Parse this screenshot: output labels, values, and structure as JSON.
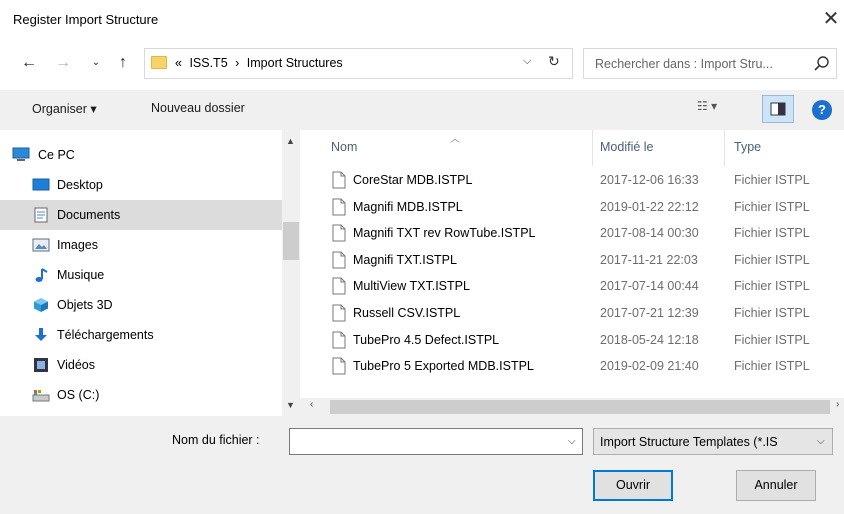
{
  "window": {
    "title": "Register Import Structure"
  },
  "address": {
    "overflow": "«",
    "crumbs": [
      "ISS.T5",
      "›",
      "Import Structures"
    ]
  },
  "search": {
    "placeholder": "Rechercher dans : Import Stru..."
  },
  "toolbar": {
    "organize": "Organiser ▾",
    "new_folder": "Nouveau dossier"
  },
  "nav": {
    "items": [
      {
        "label": "Ce PC",
        "icon": "computer-icon"
      },
      {
        "label": "Desktop",
        "icon": "desktop-icon"
      },
      {
        "label": "Documents",
        "icon": "documents-icon",
        "selected": true
      },
      {
        "label": "Images",
        "icon": "images-icon"
      },
      {
        "label": "Musique",
        "icon": "music-icon"
      },
      {
        "label": "Objets 3D",
        "icon": "3d-objects-icon"
      },
      {
        "label": "Téléchargements",
        "icon": "downloads-icon"
      },
      {
        "label": "Vidéos",
        "icon": "videos-icon"
      },
      {
        "label": "OS (C:)",
        "icon": "drive-icon"
      }
    ]
  },
  "files": {
    "columns": {
      "name": "Nom",
      "modified": "Modifié le",
      "type": "Type"
    },
    "rows": [
      {
        "name": "CoreStar MDB.ISTPL",
        "modified": "2017-12-06 16:33",
        "type": "Fichier ISTPL"
      },
      {
        "name": "Magnifi MDB.ISTPL",
        "modified": "2019-01-22 22:12",
        "type": "Fichier ISTPL"
      },
      {
        "name": "Magnifi TXT rev RowTube.ISTPL",
        "modified": "2017-08-14 00:30",
        "type": "Fichier ISTPL"
      },
      {
        "name": "Magnifi TXT.ISTPL",
        "modified": "2017-11-21 22:03",
        "type": "Fichier ISTPL"
      },
      {
        "name": "MultiView TXT.ISTPL",
        "modified": "2017-07-14 00:44",
        "type": "Fichier ISTPL"
      },
      {
        "name": "Russell CSV.ISTPL",
        "modified": "2017-07-21 12:39",
        "type": "Fichier ISTPL"
      },
      {
        "name": "TubePro 4.5 Defect.ISTPL",
        "modified": "2018-05-24 12:18",
        "type": "Fichier ISTPL"
      },
      {
        "name": "TubePro 5 Exported MDB.ISTPL",
        "modified": "2019-02-09 21:40",
        "type": "Fichier ISTPL"
      }
    ]
  },
  "bottom": {
    "filename_label": "Nom du fichier :",
    "filename_value": "",
    "filter": "Import Structure Templates (*.IS",
    "open": "Ouvrir",
    "cancel": "Annuler"
  },
  "colors": {
    "accent": "#0078d7",
    "help": "#1b6fcf",
    "selection": "#dcdcdc",
    "header_text": "#4c607a"
  }
}
